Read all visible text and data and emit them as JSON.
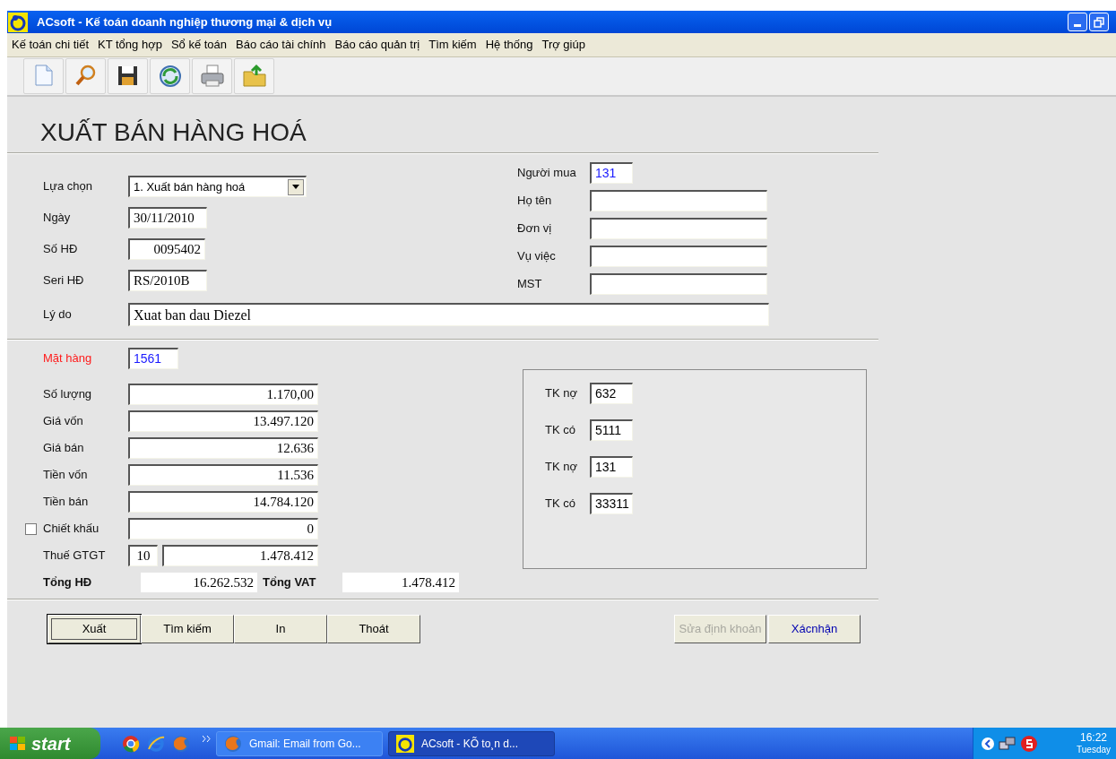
{
  "window": {
    "title": "ACsoft - Kế toán doanh nghiệp thương mại & dịch vụ"
  },
  "menu": [
    "Kế toán chi tiết",
    "KT tổng hợp",
    "Sổ kế toán",
    "Báo cáo tài chính",
    "Báo cáo quản trị",
    "Tìm kiếm",
    "Hệ thống",
    "Trợ giúp"
  ],
  "form": {
    "heading": "XUẤT BÁN HÀNG HOÁ",
    "left_fields": [
      {
        "label": "Lựa chọn",
        "value": "1. Xuất bán hàng hoá",
        "kind": "combo"
      },
      {
        "label": "Ngày",
        "value": "30/11/2010",
        "kind": "text"
      },
      {
        "label": "Số HĐ",
        "value": "0095402",
        "kind": "number"
      },
      {
        "label": "Seri HĐ",
        "value": "RS/2010B",
        "kind": "text"
      }
    ],
    "right_fields": [
      {
        "label": "Người mua",
        "value": "131",
        "kind": "code"
      },
      {
        "label": "Họ tên",
        "kind": "text"
      },
      {
        "label": "Đơn vị",
        "kind": "text"
      },
      {
        "label": "Vụ việc",
        "kind": "text"
      },
      {
        "label": "MST",
        "kind": "text"
      }
    ],
    "reason": {
      "label": "Lý do",
      "value": "Xuat ban dau Diezel"
    },
    "item": {
      "label": "Mặt hàng",
      "value": "1561",
      "required": true
    },
    "amounts": [
      {
        "label": "Số lượng",
        "value": "1.170,00",
        "kind": "amount"
      },
      {
        "label": "Giá vốn",
        "value": "13.497.120",
        "kind": "amount"
      },
      {
        "label": "Giá bán",
        "value": "12.636",
        "kind": "amount"
      },
      {
        "label": "Tiền vốn",
        "value": "11.536",
        "kind": "amount"
      },
      {
        "label": "Tiền bán",
        "value": "14.784.120",
        "kind": "amount"
      },
      {
        "label": "Chiết khấu",
        "value": "0",
        "kind": "checkbox",
        "checked": false
      },
      {
        "label": "Thuế GTGT",
        "rate": "10",
        "value": "1.478.412",
        "kind": "tax"
      }
    ],
    "totals": [
      {
        "label": "Tổng HĐ",
        "value": "16.262.532"
      },
      {
        "label": "Tổng VAT",
        "value": "1.478.412"
      }
    ],
    "accounts": [
      {
        "label": "TK nợ",
        "value": "632"
      },
      {
        "label": "TK có",
        "value": "5111"
      },
      {
        "label": "TK nợ",
        "value": "131"
      },
      {
        "label": "TK có",
        "value": "33311"
      }
    ],
    "buttons_left": [
      {
        "label": "Xuất",
        "focused": true
      },
      {
        "label": "Tìm kiếm",
        "focused": false
      },
      {
        "label": "In",
        "focused": false
      },
      {
        "label": "Thoát",
        "focused": false
      }
    ],
    "buttons_right": [
      {
        "label": "Sửa định khoản",
        "disabled": true
      },
      {
        "label": "Xácnhận",
        "disabled": false
      }
    ]
  },
  "taskbar": {
    "start": "start",
    "tasks": [
      {
        "label": "Gmail: Email from Go...",
        "active": false,
        "kind": "browser"
      },
      {
        "label": "ACsoft - KÕ to¸n d...",
        "active": true,
        "kind": "app"
      }
    ],
    "time": "16:22",
    "day": "Tuesday"
  }
}
